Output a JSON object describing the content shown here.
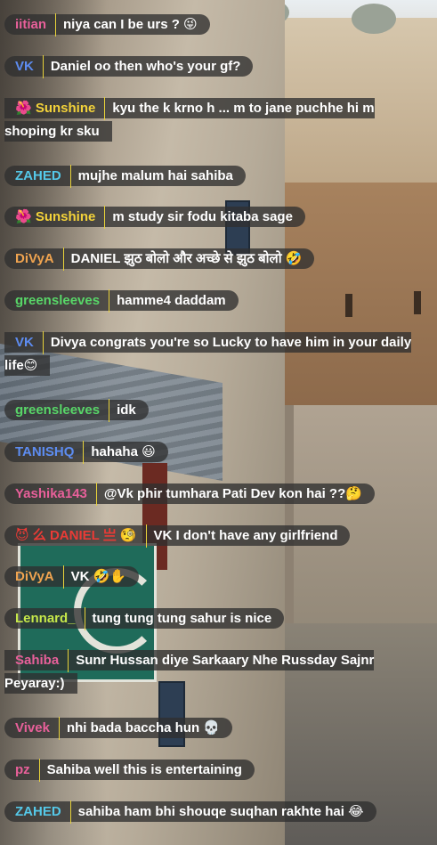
{
  "messages": [
    {
      "user": "iitian",
      "color": "#e8609a",
      "text": "niya can I be urs ? 😜"
    },
    {
      "user": "VK",
      "color": "#5d8cf0",
      "text": "Daniel oo then who's your gf?"
    },
    {
      "user": "🌺 Sunshine",
      "color": "#f3d23a",
      "text": "kyu the k krno h ... m to jane puchhe hi m shoping kr sku"
    },
    {
      "user": "ZAHED",
      "color": "#55c8e8",
      "text": "mujhe malum hai sahiba"
    },
    {
      "user": "🌺 Sunshine",
      "color": "#f3d23a",
      "text": "m study sir fodu kitaba sage"
    },
    {
      "user": "DiVyA",
      "color": "#f0a450",
      "text": "DANIEL झुठ बोलो और अच्छे से झुठ बोलो 🤣"
    },
    {
      "user": "greensleeves",
      "color": "#58d668",
      "text": "hamme4 daddam"
    },
    {
      "user": "VK",
      "color": "#5d8cf0",
      "text": "Divya congrats you're so Lucky to have him in your daily life😊"
    },
    {
      "user": "greensleeves",
      "color": "#58d668",
      "text": "idk"
    },
    {
      "user": "TANISHQ",
      "color": "#5d8cf0",
      "text": "hahaha 😃"
    },
    {
      "user": "Yashika143",
      "color": "#e8609a",
      "text": "@Vk phir tumhara Pati Dev kon hai ??🤔"
    },
    {
      "user": "😈 么 DANIEL 亗 🧐",
      "color": "#ea3b36",
      "text": "VK I don't have any girlfriend"
    },
    {
      "user": "DiVyA",
      "color": "#f0a450",
      "text": "VK 🤣✋"
    },
    {
      "user": "Lennard_",
      "color": "#c6e84a",
      "text": "tung tung tung sahur is nice"
    },
    {
      "user": "Sahiba",
      "color": "#e8609a",
      "text": "Sunr Hussan diye Sarkaary Nhe Russday Sajnr Peyaray:)"
    },
    {
      "user": "Vivek",
      "color": "#e8609a",
      "text": "nhi bada baccha hun 💀"
    },
    {
      "user": "pz",
      "color": "#e8609a",
      "text": "Sahiba well this is entertaining"
    },
    {
      "user": "ZAHED",
      "color": "#55c8e8",
      "text": "sahiba ham bhi shouqe suqhan rakhte hai 😂"
    }
  ]
}
